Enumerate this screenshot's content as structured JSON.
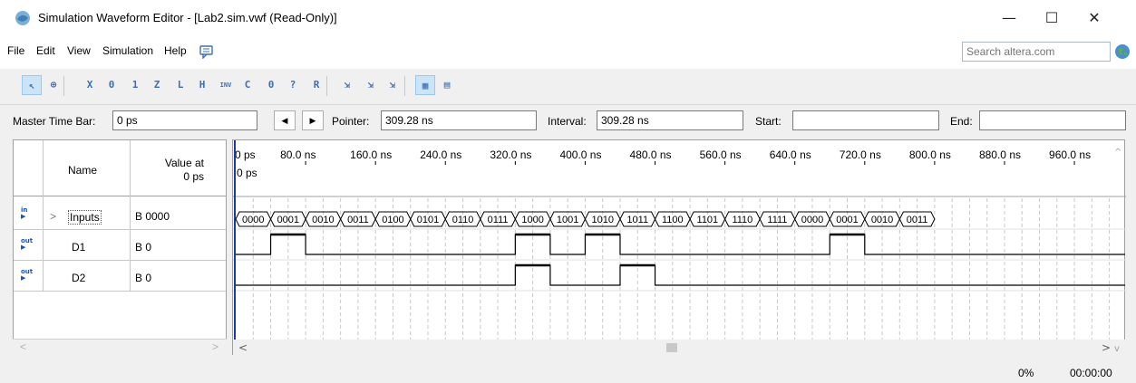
{
  "window": {
    "title": "Simulation Waveform Editor - [Lab2.sim.vwf (Read-Only)]",
    "minimize_glyph": "—",
    "maximize_glyph": "☐",
    "close_glyph": "✕"
  },
  "menu": {
    "items": [
      "File",
      "Edit",
      "View",
      "Simulation",
      "Help"
    ],
    "search_placeholder": "Search altera.com"
  },
  "toolbar": {
    "icons": [
      "select-tool-icon",
      "zoom-tool-icon",
      "forcing-unknown-icon",
      "forcing-low-icon",
      "forcing-high-icon",
      "high-impedance-icon",
      "weak-low-icon",
      "weak-high-icon",
      "invert-icon",
      "count-value-icon",
      "forcing-value-icon",
      "random-values-icon",
      "arbitrary-value-icon",
      "snap-to-grid-icon",
      "zoom-waveform-icon",
      "edit-icon",
      "grid-icon",
      "overwrite-clock-icon"
    ],
    "glyphs": [
      "↖",
      "⊕",
      "X",
      "0",
      "1",
      "Z",
      "L",
      "H",
      "INV",
      "C",
      "0",
      "?",
      "R",
      "⇲",
      "⇲",
      "⇲",
      "▦",
      "▤"
    ]
  },
  "timebar": {
    "master_label": "Master Time Bar:",
    "master_value": "0 ps",
    "pointer_label": "Pointer:",
    "pointer_value": "309.28 ns",
    "interval_label": "Interval:",
    "interval_value": "309.28 ns",
    "start_label": "Start:",
    "start_value": "",
    "end_label": "End:",
    "end_value": ""
  },
  "grid": {
    "col_name": "Name",
    "col_value_line1": "Value at",
    "col_value_line2": "0 ps",
    "signals": [
      {
        "name": "Inputs",
        "value": "B 0000",
        "type": "in",
        "expandable": true
      },
      {
        "name": "D1",
        "value": "B 0",
        "type": "out",
        "expandable": false
      },
      {
        "name": "D2",
        "value": "B 0",
        "type": "out",
        "expandable": false
      }
    ]
  },
  "waveform": {
    "time_labels": [
      "0 ps",
      "80.0 ns",
      "160.0 ns",
      "240.0 ns",
      "320.0 ns",
      "400.0 ns",
      "480.0 ns",
      "560.0 ns",
      "640.0 ns",
      "720.0 ns",
      "800.0 ns",
      "880.0 ns",
      "960.0 ns"
    ],
    "cursor_label": "0 ps",
    "time_unit_ns": 40,
    "inputs_values": [
      "0000",
      "0001",
      "0010",
      "0011",
      "0100",
      "0101",
      "0110",
      "0111",
      "1000",
      "1001",
      "1010",
      "1011",
      "1100",
      "1101",
      "1110",
      "1111",
      "0000",
      "0001",
      "0010",
      "0011"
    ],
    "d1_high_intervals_ns": [
      [
        40,
        80
      ],
      [
        320,
        360
      ],
      [
        400,
        440
      ],
      [
        680,
        720
      ]
    ],
    "d2_high_intervals_ns": [
      [
        320,
        360
      ],
      [
        440,
        480
      ]
    ]
  },
  "status": {
    "progress": "0%",
    "elapsed": "00:00:00"
  }
}
